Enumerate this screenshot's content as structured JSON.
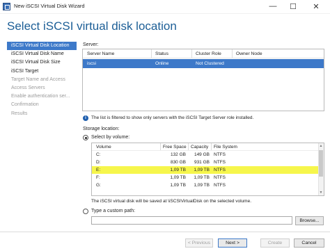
{
  "window": {
    "title": "New iSCSI Virtual Disk Wizard",
    "minimize_glyph": "—",
    "maximize_glyph": "☐",
    "close_glyph": "✕"
  },
  "page": {
    "heading": "Select iSCSI virtual disk location"
  },
  "nav": {
    "items": [
      {
        "label": "iSCSI Virtual Disk Location",
        "state": "active"
      },
      {
        "label": "iSCSI Virtual Disk Name",
        "state": "normal"
      },
      {
        "label": "iSCSI Virtual Disk Size",
        "state": "normal"
      },
      {
        "label": "iSCSI Target",
        "state": "normal"
      },
      {
        "label": "Target Name and Access",
        "state": "disabled"
      },
      {
        "label": "Access Servers",
        "state": "disabled"
      },
      {
        "label": "Enable authentication ser...",
        "state": "disabled"
      },
      {
        "label": "Confirmation",
        "state": "disabled"
      },
      {
        "label": "Results",
        "state": "disabled"
      }
    ]
  },
  "servers": {
    "label": "Server:",
    "columns": [
      "Server Name",
      "Status",
      "Cluster Role",
      "Owner Node"
    ],
    "rows": [
      {
        "name": "iscsi",
        "status": "Online",
        "cluster_role": "Not Clustered",
        "owner_node": ""
      }
    ]
  },
  "info": {
    "icon": "info-icon",
    "icon_glyph": "i",
    "text": "The list is filtered to show only servers with the iSCSI Target Server role installed."
  },
  "storage": {
    "label": "Storage location:",
    "select_by_volume_label": "Select by volume:",
    "custom_path_label": "Type a custom path:",
    "custom_path_value": "",
    "browse_label": "Browse...",
    "columns": [
      "Volume",
      "Free Space",
      "Capacity",
      "File System"
    ],
    "rows": [
      {
        "volume": "C:",
        "free": "132 GB",
        "capacity": "149 GB",
        "fs": "NTFS"
      },
      {
        "volume": "D:",
        "free": "830 GB",
        "capacity": "931 GB",
        "fs": "NTFS"
      },
      {
        "volume": "E:",
        "free": "1,09 TB",
        "capacity": "1,09 TB",
        "fs": "NTFS"
      },
      {
        "volume": "F:",
        "free": "1,09 TB",
        "capacity": "1,09 TB",
        "fs": "NTFS"
      },
      {
        "volume": "G:",
        "free": "1,09 TB",
        "capacity": "1,09 TB",
        "fs": "NTFS"
      }
    ],
    "highlight_color": "#f6f64c",
    "save_note": "The iSCSI virtual disk will be saved at \\iSCSIVirtualDisk on the selected volume."
  },
  "footer": {
    "previous": "< Previous",
    "next": "Next >",
    "create": "Create",
    "cancel": "Cancel"
  },
  "colors": {
    "accent": "#3d79c9",
    "heading": "#1c5e96"
  }
}
